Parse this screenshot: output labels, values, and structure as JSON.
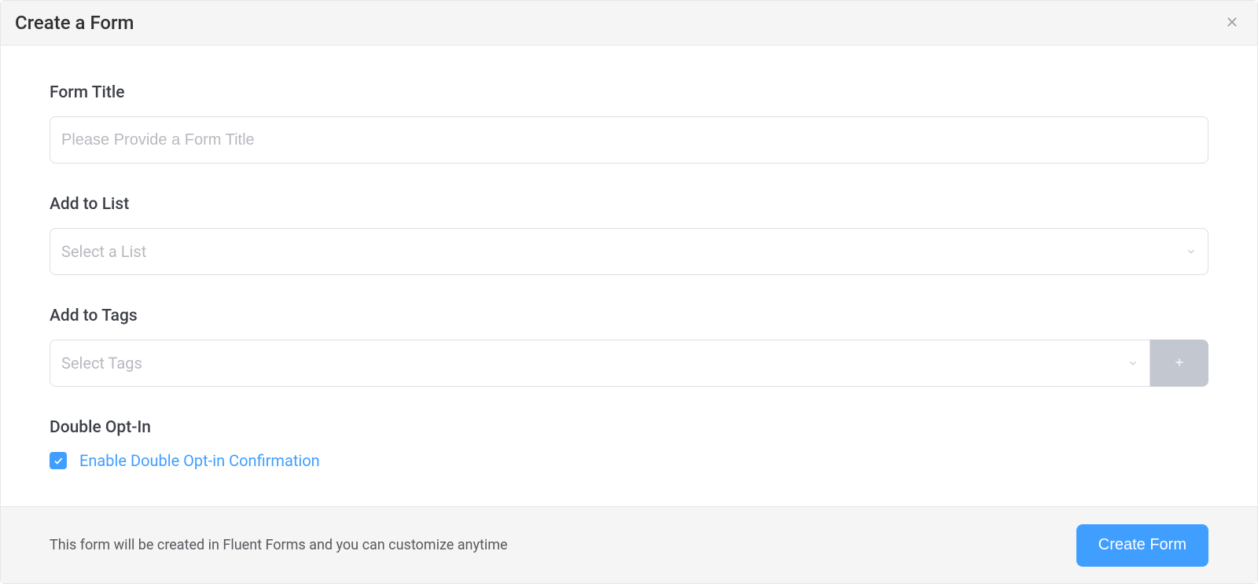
{
  "modal": {
    "title": "Create a Form"
  },
  "form_title": {
    "label": "Form Title",
    "placeholder": "Please Provide a Form Title",
    "value": ""
  },
  "add_to_list": {
    "label": "Add to List",
    "placeholder": "Select a List",
    "selected": ""
  },
  "add_to_tags": {
    "label": "Add to Tags",
    "placeholder": "Select Tags",
    "selected": ""
  },
  "double_opt_in": {
    "label": "Double Opt-In",
    "checkbox_label": "Enable Double Opt-in Confirmation",
    "checked": true
  },
  "footer": {
    "note": "This form will be created in Fluent Forms and you can customize anytime",
    "button": "Create Form"
  }
}
